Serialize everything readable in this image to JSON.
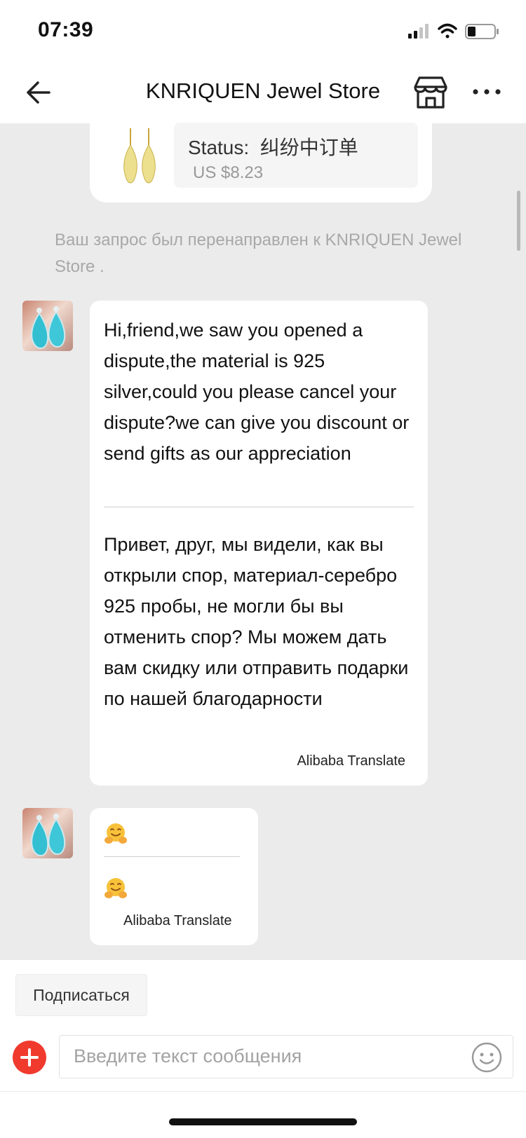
{
  "status_bar": {
    "time": "07:39",
    "icons": [
      "cellular-signal-icon",
      "wifi-icon",
      "battery-icon"
    ]
  },
  "header": {
    "title": "KNRIQUEN Jewel Store",
    "icons": [
      "back-arrow-icon",
      "store-icon",
      "more-icon"
    ]
  },
  "order": {
    "status_label": "Status:",
    "status_value": "纠纷中订单",
    "price": "US $8.23"
  },
  "system_message": "Ваш запрос был перенаправлен к KNRIQUEN Jewel Store .",
  "messages": [
    {
      "original": "Hi,friend,we saw you opened a dispute,the material is 925 silver,could you please cancel your dispute?we can give you discount or send gifts as our appreciation",
      "translated": "Привет, друг, мы видели, как вы открыли спор, материал-серебро 925 пробы, не могли бы вы отменить спор? Мы можем дать вам скидку или отправить подарки по нашей благодарности",
      "translator": "Alibaba Translate"
    },
    {
      "original_emoji": "hugging-face",
      "translated_emoji": "hugging-face",
      "translator": "Alibaba Translate"
    }
  ],
  "footer": {
    "subscribe_label": "Подписаться",
    "input_placeholder": "Введите текст сообщения",
    "icons": [
      "add-icon",
      "emoji-icon"
    ]
  },
  "colors": {
    "accent": "#f03a2e",
    "chat_background": "#ebebeb",
    "bubble": "#ffffff"
  }
}
